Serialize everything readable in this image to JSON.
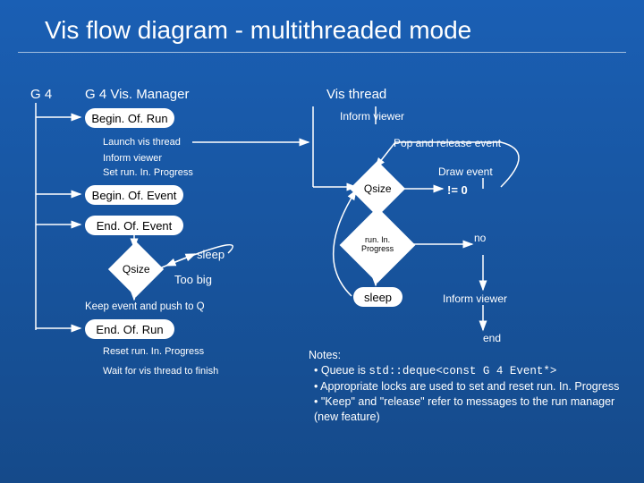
{
  "title": "Vis flow diagram - multithreaded mode",
  "left": {
    "g4": "G 4",
    "manager": "G 4 Vis. Manager",
    "beginRun": "Begin. Of. Run",
    "launchVis": "Launch vis thread",
    "informViewer": "Inform viewer",
    "setRunInProgress": "Set run. In. Progress",
    "beginEvent": "Begin. Of. Event",
    "endEvent": "End. Of. Event",
    "qsize": "Qsize",
    "sleep": "sleep",
    "tooBig": "Too big",
    "keep": "Keep event and push to Q",
    "endRun": "End. Of. Run",
    "resetRunInProgress": "Reset run. In. Progress",
    "waitVis": "Wait for vis thread to finish"
  },
  "right": {
    "visThread": "Vis thread",
    "informViewer": "Inform viewer",
    "popRelease": "Pop and release event",
    "drawEvent": "Draw event",
    "qsize": "Qsize",
    "neqZero": "!= 0",
    "runInProgress": "run. In. Progress",
    "no": "no",
    "sleep": "sleep",
    "informViewer2": "Inform viewer",
    "end": "end"
  },
  "notes": {
    "hdr": "Notes:",
    "n1": "Queue is std::deque<const G4Event*>",
    "n1_prefix": "Queue is ",
    "n1_mono": "std::deque<const G 4 Event*>",
    "n2": "Appropriate locks are used to set and reset run. In. Progress",
    "n3": "\"Keep\" and \"release\" refer to messages to the run manager (new feature)"
  }
}
